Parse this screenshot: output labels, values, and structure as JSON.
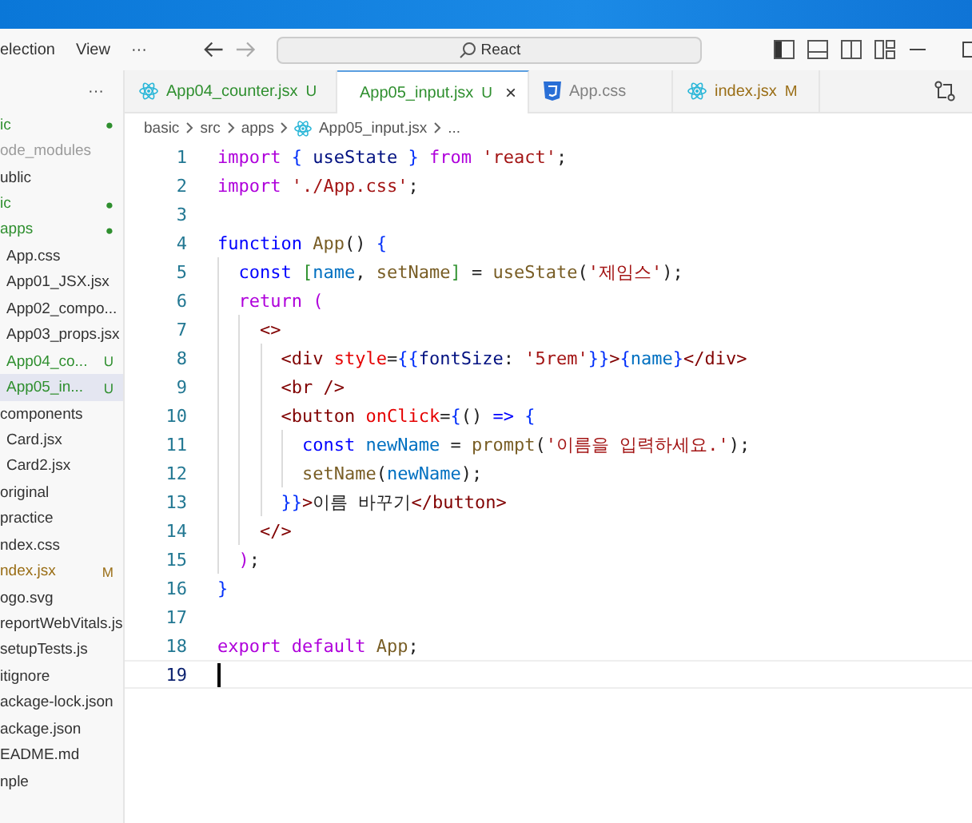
{
  "menu": [
    "election",
    "View",
    "···"
  ],
  "search": {
    "value": "React"
  },
  "explorer": {
    "more": "···",
    "items": [
      {
        "label": "ic",
        "color": "#2f8f2f",
        "badge": "●",
        "selected": false,
        "children": [
          {
            "label": "ode_modules",
            "color": "#9c9c9c",
            "selected": false
          },
          {
            "label": "ublic",
            "color": "#333333",
            "selected": false
          },
          {
            "label": "ic",
            "color": "#2f8f2f",
            "badge": "●",
            "selected": false,
            "children": [
              {
                "label": "apps",
                "color": "#2f8f2f",
                "badge": "●",
                "selected": false,
                "children": [
                  {
                    "label": "App.css",
                    "color": "#333333",
                    "selected": false
                  },
                  {
                    "label": "App01_JSX.jsx",
                    "color": "#333333",
                    "selected": false
                  },
                  {
                    "label": "App02_compo...",
                    "color": "#333333",
                    "selected": false
                  },
                  {
                    "label": "App03_props.jsx",
                    "color": "#333333",
                    "selected": false
                  },
                  {
                    "label": "App04_co...",
                    "color": "#2f8f2f",
                    "badge": "U",
                    "selected": false
                  },
                  {
                    "label": "App05_in...",
                    "color": "#2f8f2f",
                    "badge": "U",
                    "selected": true
                  }
                ]
              },
              {
                "label": "components",
                "color": "#333333",
                "selected": false,
                "children": [
                  {
                    "label": "Card.jsx",
                    "color": "#333333",
                    "selected": false
                  },
                  {
                    "label": "Card2.jsx",
                    "color": "#333333",
                    "selected": false
                  }
                ]
              },
              {
                "label": "original",
                "color": "#333333",
                "selected": false
              },
              {
                "label": "practice",
                "color": "#333333",
                "selected": false
              },
              {
                "label": "ndex.css",
                "color": "#333333",
                "selected": false
              },
              {
                "label": "ndex.jsx",
                "color": "#9a6e16",
                "badge": "M",
                "selected": false
              },
              {
                "label": "ogo.svg",
                "color": "#333333",
                "selected": false
              },
              {
                "label": "reportWebVitals.js",
                "color": "#333333",
                "selected": false
              },
              {
                "label": "setupTests.js",
                "color": "#333333",
                "selected": false
              }
            ]
          },
          {
            "label": "itignore",
            "color": "#333333",
            "selected": false
          },
          {
            "label": "ackage-lock.json",
            "color": "#333333",
            "selected": false
          },
          {
            "label": "ackage.json",
            "color": "#333333",
            "selected": false
          },
          {
            "label": "EADME.md",
            "color": "#333333",
            "selected": false
          }
        ]
      },
      {
        "label": "nple",
        "color": "#333333",
        "selected": false
      }
    ]
  },
  "tabs": [
    {
      "label": "App04_counter.jsx",
      "kind": "react",
      "color": "#2f8f2f",
      "badge": "U",
      "selected": false
    },
    {
      "label": "App05_input.jsx",
      "kind": "react",
      "color": "#2f8f2f",
      "badge": "U",
      "selected": true,
      "close": "×"
    },
    {
      "label": "App.css",
      "kind": "css",
      "color": "#808080",
      "selected": false
    },
    {
      "label": "index.jsx",
      "kind": "react",
      "color": "#9a6e16",
      "badge": "M",
      "selected": false
    }
  ],
  "breadcrumb": [
    "basic",
    "src",
    "apps",
    "App05_input.jsx",
    "..."
  ],
  "code": [
    {
      "number": "1",
      "active": false,
      "tokens": [
        {
          "kind": "control",
          "text": "import "
        },
        {
          "kind": "brace",
          "text": "{ "
        },
        {
          "kind": "var",
          "text": "useState "
        },
        {
          "kind": "brace",
          "text": "} "
        },
        {
          "kind": "control",
          "text": "from "
        },
        {
          "kind": "string",
          "text": "'react'"
        },
        {
          "kind": "text",
          "text": ";"
        }
      ]
    },
    {
      "number": "2",
      "active": false,
      "tokens": [
        {
          "kind": "control",
          "text": "import "
        },
        {
          "kind": "string",
          "text": "'./App.css'"
        },
        {
          "kind": "text",
          "text": ";"
        }
      ]
    },
    {
      "number": "3",
      "active": false
    },
    {
      "number": "4",
      "active": false,
      "tokens": [
        {
          "kind": "storage",
          "text": "function "
        },
        {
          "kind": "func",
          "text": "App"
        },
        {
          "kind": "text",
          "text": "() "
        },
        {
          "kind": "brace",
          "text": "{"
        }
      ]
    },
    {
      "number": "5",
      "active": false,
      "tokens": [
        {
          "kind": "storage",
          "text": "  const "
        },
        {
          "kind": "bracket",
          "text": "["
        },
        {
          "kind": "const",
          "text": "name"
        },
        {
          "kind": "text",
          "text": ", "
        },
        {
          "kind": "func",
          "text": "setName"
        },
        {
          "kind": "bracket",
          "text": "]"
        },
        {
          "kind": "text",
          "text": " = "
        },
        {
          "kind": "func",
          "text": "useState"
        },
        {
          "kind": "text",
          "text": "("
        },
        {
          "kind": "string",
          "text": "'제임스'"
        },
        {
          "kind": "text",
          "text": ");"
        }
      ]
    },
    {
      "number": "6",
      "active": false,
      "tokens": [
        {
          "kind": "control",
          "text": "  return "
        },
        {
          "kind": "paren",
          "text": "("
        }
      ]
    },
    {
      "number": "7",
      "active": false,
      "tokens": [
        {
          "kind": "tag",
          "text": "    <>"
        }
      ]
    },
    {
      "number": "8",
      "active": false,
      "tokens": [
        {
          "kind": "tag",
          "text": "      <div "
        },
        {
          "kind": "attr",
          "text": "style"
        },
        {
          "kind": "text",
          "text": "="
        },
        {
          "kind": "brace",
          "text": "{{"
        },
        {
          "kind": "var",
          "text": "fontSize"
        },
        {
          "kind": "text",
          "text": ": "
        },
        {
          "kind": "string",
          "text": "'5rem'"
        },
        {
          "kind": "brace",
          "text": "}}"
        },
        {
          "kind": "tag",
          "text": ">"
        },
        {
          "kind": "brace",
          "text": "{"
        },
        {
          "kind": "const",
          "text": "name"
        },
        {
          "kind": "brace",
          "text": "}"
        },
        {
          "kind": "tag",
          "text": "</div>"
        }
      ]
    },
    {
      "number": "9",
      "active": false,
      "tokens": [
        {
          "kind": "tag",
          "text": "      <br />"
        }
      ]
    },
    {
      "number": "10",
      "active": false,
      "tokens": [
        {
          "kind": "tag",
          "text": "      <button "
        },
        {
          "kind": "attr",
          "text": "onClick"
        },
        {
          "kind": "text",
          "text": "="
        },
        {
          "kind": "brace",
          "text": "{"
        },
        {
          "kind": "text",
          "text": "() "
        },
        {
          "kind": "storage",
          "text": "=> "
        },
        {
          "kind": "brace",
          "text": "{"
        }
      ]
    },
    {
      "number": "11",
      "active": false,
      "tokens": [
        {
          "kind": "storage",
          "text": "        const "
        },
        {
          "kind": "const",
          "text": "newName"
        },
        {
          "kind": "text",
          "text": " = "
        },
        {
          "kind": "func",
          "text": "prompt"
        },
        {
          "kind": "text",
          "text": "("
        },
        {
          "kind": "string",
          "text": "'이름을 입력하세요.'"
        },
        {
          "kind": "text",
          "text": ");"
        }
      ]
    },
    {
      "number": "12",
      "active": false,
      "tokens": [
        {
          "kind": "func",
          "text": "        setName"
        },
        {
          "kind": "text",
          "text": "("
        },
        {
          "kind": "const",
          "text": "newName"
        },
        {
          "kind": "text",
          "text": ");"
        }
      ]
    },
    {
      "number": "13",
      "active": false,
      "tokens": [
        {
          "kind": "brace",
          "text": "      }}"
        },
        {
          "kind": "tag",
          "text": ">"
        },
        {
          "kind": "text",
          "text": "이름 바꾸기"
        },
        {
          "kind": "tag",
          "text": "</button>"
        }
      ]
    },
    {
      "number": "14",
      "active": false,
      "tokens": [
        {
          "kind": "tag",
          "text": "    </>"
        }
      ]
    },
    {
      "number": "15",
      "active": false,
      "tokens": [
        {
          "kind": "paren",
          "text": "  )"
        },
        {
          "kind": "text",
          "text": ";"
        }
      ]
    },
    {
      "number": "16",
      "active": false,
      "tokens": [
        {
          "kind": "brace",
          "text": "}"
        }
      ]
    },
    {
      "number": "17",
      "active": false
    },
    {
      "number": "18",
      "active": false,
      "tokens": [
        {
          "kind": "control",
          "text": "export default "
        },
        {
          "kind": "func",
          "text": "App"
        },
        {
          "kind": "text",
          "text": ";"
        }
      ]
    },
    {
      "number": "19",
      "active": true
    }
  ]
}
